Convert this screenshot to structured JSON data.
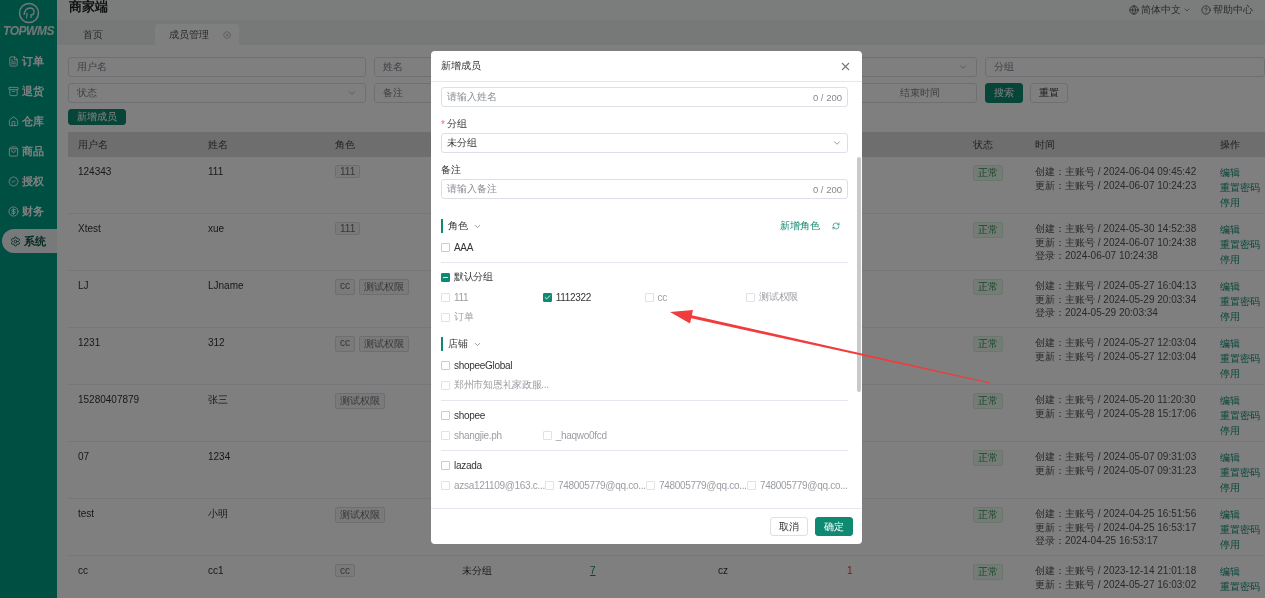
{
  "app": {
    "logo_text": "TOPWMS",
    "title": "商家端",
    "language": "简体中文",
    "help": "帮助中心"
  },
  "sidebar": {
    "items": [
      {
        "label": "订单",
        "selected": false
      },
      {
        "label": "退货",
        "selected": false
      },
      {
        "label": "仓库",
        "selected": false
      },
      {
        "label": "商品",
        "selected": false
      },
      {
        "label": "授权",
        "selected": false
      },
      {
        "label": "财务",
        "selected": false
      },
      {
        "label": "系统",
        "selected": true
      }
    ]
  },
  "tabs": [
    {
      "label": "首页",
      "selected": false,
      "closable": false
    },
    {
      "label": "成员管理",
      "selected": true,
      "closable": true
    }
  ],
  "filters": [
    [
      {
        "kind": "input",
        "placeholder": "用户名"
      },
      {
        "kind": "input",
        "placeholder": "姓名"
      },
      {
        "kind": "select"
      },
      {
        "kind": "input",
        "placeholder": "分组"
      }
    ],
    [
      {
        "kind": "select",
        "placeholder": "状态"
      },
      {
        "kind": "input",
        "placeholder": "备注"
      },
      {
        "kind": "range_end",
        "placeholder": "结束时间"
      }
    ]
  ],
  "filter_buttons": [
    {
      "label": "搜索",
      "primary": true
    },
    {
      "label": "重置",
      "primary": false
    }
  ],
  "add_button": "新增成员",
  "table": {
    "columns": [
      "用户名",
      "姓名",
      "角色",
      "",
      "",
      "",
      "",
      "状态",
      "时间",
      "操作"
    ],
    "rows": [
      {
        "username": "124343",
        "name": "111",
        "roles": [
          "111"
        ],
        "status": "正常",
        "times": [
          "创建：主账号 / 2024-06-04 09:45:42",
          "更新：主账号 / 2024-06-07 10:24:23"
        ],
        "actions": [
          "编辑",
          "重置密码",
          "停用"
        ]
      },
      {
        "username": "Xtest",
        "name": "xue",
        "roles": [
          "111"
        ],
        "status": "正常",
        "times": [
          "创建：主账号 / 2024-05-30 14:52:38",
          "更新：主账号 / 2024-06-07 10:24:38",
          "登录：2024-06-07 10:24:38"
        ],
        "actions": [
          "编辑",
          "重置密码",
          "停用"
        ]
      },
      {
        "username": "LJ",
        "name": "LJname",
        "roles": [
          "cc",
          "测试权限"
        ],
        "status": "正常",
        "times": [
          "创建：主账号 / 2024-05-27 16:04:13",
          "更新：主账号 / 2024-05-29 20:03:34",
          "登录：2024-05-29 20:03:34"
        ],
        "actions": [
          "编辑",
          "重置密码",
          "停用"
        ]
      },
      {
        "username": "1231",
        "name": "312",
        "roles": [
          "cc",
          "测试权限"
        ],
        "status": "正常",
        "times": [
          "创建：主账号 / 2024-05-27 12:03:04",
          "更新：主账号 / 2024-05-27 12:03:04"
        ],
        "actions": [
          "编辑",
          "重置密码",
          "停用"
        ]
      },
      {
        "username": "15280407879",
        "name": "张三",
        "roles": [
          "测试权限"
        ],
        "status": "正常",
        "times": [
          "创建：主账号 / 2024-05-20 11:20:30",
          "更新：主账号 / 2024-05-28 15:17:06"
        ],
        "actions": [
          "编辑",
          "重置密码",
          "停用"
        ]
      },
      {
        "username": "07",
        "name": "1234",
        "roles": [],
        "status": "正常",
        "times": [
          "创建：主账号 / 2024-05-07 09:31:03",
          "更新：主账号 / 2024-05-07 09:31:23"
        ],
        "actions": [
          "编辑",
          "重置密码",
          "停用"
        ]
      },
      {
        "username": "test",
        "name": "小明",
        "roles": [
          "测试权限"
        ],
        "status": "正常",
        "times": [
          "创建：主账号 / 2024-04-25 16:51:56",
          "更新：主账号 / 2024-04-25 16:53:17",
          "登录：2024-04-25 16:53:17"
        ],
        "actions": [
          "编辑",
          "重置密码",
          "停用"
        ]
      },
      {
        "username": "cc",
        "name": "cc1",
        "roles": [
          "cc"
        ],
        "group": "未分组",
        "column_5": "7",
        "column_6": "cz",
        "column_7": "1",
        "status": "正常",
        "times": [
          "创建：主账号 / 2023-12-14 21:01:18",
          "更新：主账号 / 2024-05-27 16:03:02"
        ],
        "actions": [
          "编辑",
          "重置密码"
        ]
      }
    ]
  },
  "modal": {
    "title": "新增成员",
    "name_field": {
      "placeholder": "请输入姓名",
      "counter": "0 / 200"
    },
    "group_field": {
      "label": "分组",
      "required_mark": "*",
      "value": "未分组"
    },
    "remark_field": {
      "label": "备注",
      "placeholder": "请输入备注",
      "counter": "0 / 200"
    },
    "roles": {
      "title": "角色",
      "expanded": true,
      "add_link": "新增角色",
      "groups": [
        {
          "label": "AAA",
          "checked": false,
          "indeterminate": false
        },
        {
          "label": "默认分组",
          "checked": false,
          "indeterminate": true,
          "items": [
            {
              "label": "111",
              "checked": false,
              "disabled": true
            },
            {
              "label": "1112322",
              "checked": true,
              "disabled": false
            },
            {
              "label": "cc",
              "checked": false,
              "disabled": true
            },
            {
              "label": "测试权限",
              "checked": false,
              "disabled": true
            },
            {
              "label": "订单",
              "checked": false,
              "disabled": true
            }
          ]
        }
      ]
    },
    "shops": {
      "title": "店铺",
      "expanded": true,
      "groups": [
        {
          "label": "shopeeGlobal",
          "checked": false,
          "indeterminate": false,
          "items": [
            {
              "label": "郑州市知恩礼家政服...",
              "checked": false,
              "disabled": true
            }
          ]
        },
        {
          "label": "shopee",
          "checked": false,
          "indeterminate": false,
          "items": [
            {
              "label": "shangjie.ph",
              "checked": false,
              "disabled": true
            },
            {
              "label": "_haqwo0fcd",
              "checked": false,
              "disabled": true
            }
          ]
        },
        {
          "label": "lazada",
          "checked": false,
          "indeterminate": false,
          "items": [
            {
              "label": "azsa121109@163.c...",
              "checked": false,
              "disabled": true
            },
            {
              "label": "748005779@qq.co...",
              "checked": false,
              "disabled": true
            },
            {
              "label": "748005779@qq.co...",
              "checked": false,
              "disabled": true
            },
            {
              "label": "748005779@qq.co...",
              "checked": false,
              "disabled": true
            }
          ]
        }
      ]
    },
    "buttons": [
      {
        "label": "取消",
        "primary": false
      },
      {
        "label": "确定",
        "primary": true
      }
    ]
  }
}
